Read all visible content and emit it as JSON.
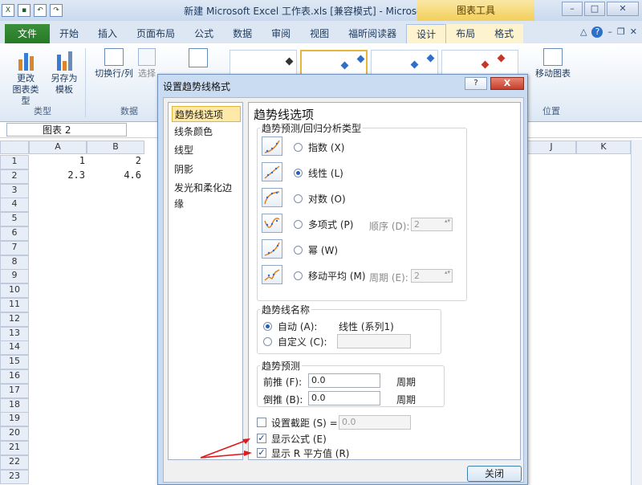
{
  "window": {
    "title": "新建 Microsoft Excel 工作表.xls  [兼容模式] - Microsoft Excel",
    "chart_tools": "图表工具"
  },
  "tabs": [
    "文件",
    "开始",
    "插入",
    "页面布局",
    "公式",
    "数据",
    "审阅",
    "视图",
    "福昕阅读器",
    "设计",
    "布局",
    "格式"
  ],
  "ribbon": {
    "change_type": "更改\n图表类型",
    "save_template": "另存为\n模板",
    "switch_row_col": "切换行/列",
    "select_data": "选择",
    "move_chart": "移动图表",
    "groups": {
      "type": "类型",
      "data": "数据",
      "location": "位置"
    }
  },
  "name_box": "图表 2",
  "columns": [
    "A",
    "B",
    "J",
    "K"
  ],
  "rows": [
    "1",
    "2",
    "3",
    "4",
    "5",
    "6",
    "7",
    "8",
    "9",
    "10",
    "11",
    "12",
    "13",
    "14",
    "15",
    "16",
    "17",
    "18",
    "19",
    "20",
    "21",
    "22",
    "23"
  ],
  "cells": {
    "A1": "1",
    "B1": "2",
    "A2": "2.3",
    "B2": "4.6"
  },
  "dialog": {
    "title": "设置趋势线格式",
    "help": "?",
    "close_x": "X",
    "nav": [
      "趋势线选项",
      "线条颜色",
      "线型",
      "阴影",
      "发光和柔化边缘"
    ],
    "heading": "趋势线选项",
    "type_group": "趋势预测/回归分析类型",
    "types": [
      {
        "label": "指数 (X)",
        "selected": false
      },
      {
        "label": "线性 (L)",
        "selected": true
      },
      {
        "label": "对数 (O)",
        "selected": false
      },
      {
        "label": "多项式 (P)",
        "selected": false
      },
      {
        "label": "幂 (W)",
        "selected": false
      },
      {
        "label": "移动平均 (M)",
        "selected": false
      }
    ],
    "order_label": "顺序 (D):",
    "order_value": "2",
    "period_label": "周期 (E):",
    "period_value": "2",
    "name_group": "趋势线名称",
    "auto_label": "自动 (A):",
    "auto_value": "线性 (系列1)",
    "custom_label": "自定义 (C):",
    "forecast_group": "趋势预测",
    "forward_label": "前推 (F):",
    "forward_value": "0.0",
    "backward_label": "倒推 (B):",
    "backward_value": "0.0",
    "period_unit": "周期",
    "intercept_label": "设置截距 (S) =",
    "intercept_value": "0.0",
    "show_equation": "显示公式 (E)",
    "show_r2": "显示 R 平方值 (R)",
    "close_button": "关闭"
  },
  "colors": {
    "accent": "#1f62b8",
    "file_tab": "#2f862e",
    "arrow": "#e0191b"
  }
}
